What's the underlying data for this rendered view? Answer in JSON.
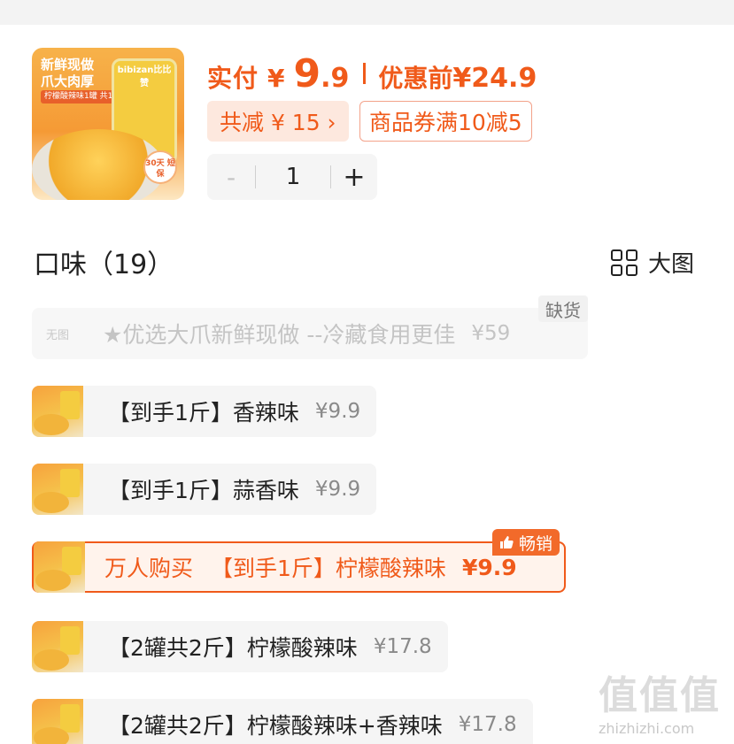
{
  "product": {
    "thumb_slogan_line1": "新鲜现做",
    "thumb_slogan_line2": "爪大肉厚",
    "thumb_subtext": "柠檬酸辣味1罐 共1斤",
    "thumb_brand": "bibizan比比赞",
    "thumb_badge": "30天 短保",
    "price_label": "实付",
    "price_currency": "¥",
    "price_integer": "9",
    "price_decimal": ".9",
    "original_label": "优惠前",
    "original_price": "¥24.9",
    "savings_text": "共减 ¥ 15 ›",
    "coupon_text": "商品券满10减5"
  },
  "quantity": {
    "minus": "-",
    "value": "1",
    "plus": "+"
  },
  "section": {
    "title": "口味（19）",
    "view_toggle_label": "大图"
  },
  "options": {
    "unavailable": {
      "no_image": "无图",
      "label": "★优选大爪新鲜现做 --冷藏食用更佳",
      "price": "¥59",
      "badge": "缺货"
    },
    "items": [
      {
        "label": "【到手1斤】香辣味",
        "price": "¥9.9"
      },
      {
        "label": "【到手1斤】蒜香味",
        "price": "¥9.9"
      },
      {
        "prefix": "万人购买",
        "label": "【到手1斤】柠檬酸辣味",
        "price": "¥9.9",
        "badge": "畅销",
        "selected": true
      },
      {
        "label": "【2罐共2斤】柠檬酸辣味",
        "price": "¥17.8"
      },
      {
        "label": "【2罐共2斤】柠檬酸辣味+香辣味",
        "price": "¥17.8"
      }
    ]
  },
  "watermark": {
    "logo": "值值值",
    "url": "zhizhizhi.com"
  },
  "colors": {
    "accent": "#f05a1a",
    "accent_bg": "#fde8de",
    "option_bg": "#f5f5f5"
  }
}
